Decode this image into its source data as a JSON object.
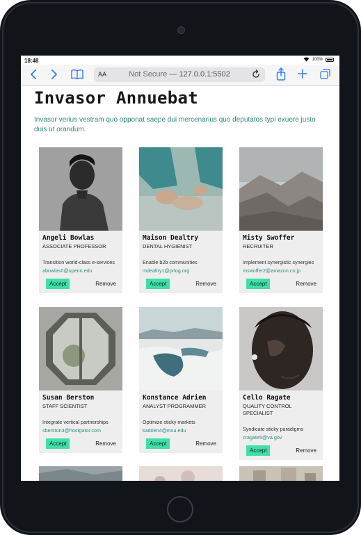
{
  "status_bar": {
    "time": "18:48",
    "battery": "100%"
  },
  "browser": {
    "aa_label": "AA",
    "not_secure": "Not Secure —",
    "url": "127.0.0.1:5502"
  },
  "page": {
    "title": "Invasor Annuebat",
    "description": "Invasor verius vestram quo opponat saepe dui mercenarius quo deputatos typi exuere justo duis ut orandum."
  },
  "cards": [
    {
      "name": "Angeli Bowlas",
      "role": "Associate Professor",
      "text": "Transition world-class e-services",
      "email": "abowlas0@upenn.edu",
      "accept": "Accept",
      "remove": "Remove"
    },
    {
      "name": "Maison Dealtry",
      "role": "Dental Hygienist",
      "text": "Enable b2b communities",
      "email": "mdealtry1@prlog.org",
      "accept": "Accept",
      "remove": "Remove"
    },
    {
      "name": "Misty Swoffer",
      "role": "Recruiter",
      "text": "Implement synergistic synergies",
      "email": "mswoffer2@amazon.co.jp",
      "accept": "Accept",
      "remove": "Remove"
    },
    {
      "name": "Susan Berston",
      "role": "Staff Scientist",
      "text": "Integrate vertical partnerships",
      "email": "sberston3@hostgator.com",
      "accept": "Accept",
      "remove": "Remove"
    },
    {
      "name": "Konstance Adrien",
      "role": "Analyst Programmer",
      "text": "Optimize sticky markets",
      "email": "kadrien4@msu.edu",
      "accept": "Accept",
      "remove": "Remove"
    },
    {
      "name": "Cello Ragate",
      "role": "Quality Control Specialist",
      "text": "Syndicate sticky paradigms",
      "email": "cragate5@va.gov",
      "accept": "Accept",
      "remove": "Remove"
    }
  ],
  "colors": {
    "accent": "#3ee0a6",
    "link": "#2f8a7d",
    "browser_blue": "#2f7bf6"
  }
}
